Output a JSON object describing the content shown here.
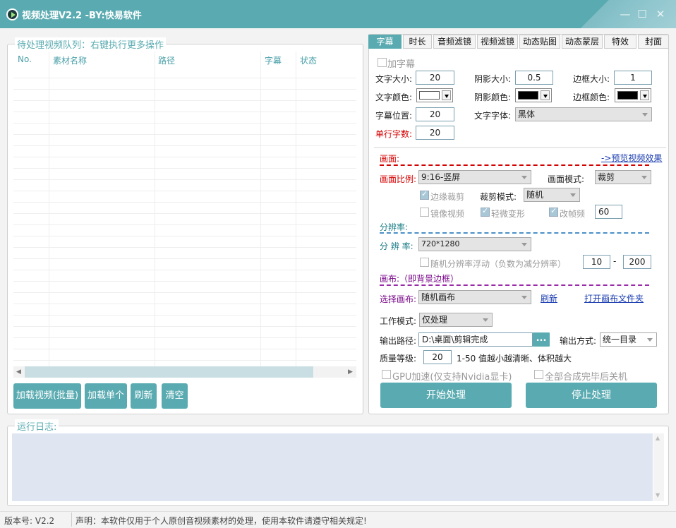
{
  "window": {
    "title": "视频处理V2.2 -BY:快易软件",
    "minimize": "—",
    "maximize": "☐",
    "close": "✕"
  },
  "queue": {
    "legend": "待处理视频队列：右键执行更多操作",
    "columns": [
      "No.",
      "素材名称",
      "路径",
      "字幕",
      "状态"
    ],
    "buttons": {
      "load_batch": "加载视频(批量)",
      "load_single": "加载单个",
      "refresh": "刷新",
      "clear": "清空"
    }
  },
  "tabs": [
    "字幕",
    "时长",
    "音频滤镜",
    "视频滤镜",
    "动态贴图",
    "动态蒙层",
    "特效",
    "封面"
  ],
  "subtitle": {
    "add_subtitle": "加字幕",
    "font_size_label": "文字大小:",
    "font_size": "20",
    "shadow_size_label": "阴影大小:",
    "shadow_size": "0.5",
    "border_size_label": "边框大小:",
    "border_size": "1",
    "font_color_label": "文字颜色:",
    "shadow_color_label": "阴影颜色:",
    "border_color_label": "边框颜色:",
    "position_label": "字幕位置:",
    "position": "20",
    "font_family_label": "文字字体:",
    "font_family": "黑体",
    "chars_per_line_label": "单行字数:",
    "chars_per_line": "20"
  },
  "frame": {
    "heading": "画面:",
    "preview_link": "->预览视频效果",
    "ratio_label": "画面比例:",
    "ratio": "9:16-竖屏",
    "mode_label": "画面模式:",
    "mode": "裁剪",
    "edge_crop": "边缘裁剪",
    "crop_mode_label": "裁剪模式:",
    "crop_mode": "随机",
    "mirror": "镜像视频",
    "slight_deform": "轻微变形",
    "change_fps": "改帧频",
    "fps": "60"
  },
  "resolution": {
    "heading": "分辨率:",
    "label": "分 辨 率:",
    "value": "720*1280",
    "random_float": "随机分辨率浮动（负数为减分辨率）",
    "min": "10",
    "dash": "-",
    "max": "200"
  },
  "canvas": {
    "heading": "画布:（即背景边框）",
    "label": "选择画布:",
    "value": "随机画布",
    "refresh_link": "刷新",
    "open_folder_link": "打开画布文件夹"
  },
  "work": {
    "mode_label": "工作模式:",
    "mode": "仅处理",
    "output_path_label": "输出路径:",
    "output_path": "D:\\桌面\\剪辑完成",
    "browse": "...",
    "output_method_label": "输出方式:",
    "output_method": "统一目录",
    "quality_label": "质量等级:",
    "quality": "20",
    "quality_hint": "1-50 值越小越清晰、体积越大",
    "gpu": "GPU加速(仅支持Nvidia显卡)",
    "shutdown": "全部合成完毕后关机",
    "start": "开始处理",
    "stop": "停止处理"
  },
  "log": {
    "legend": "运行日志:"
  },
  "status": {
    "version": "版本号: V2.2",
    "notice": "声明：本软件仅用于个人原创音视频素材的处理，使用本软件请遵守相关规定!"
  },
  "colors": {
    "accent": "#5aabb1",
    "font_color": "#ffffff",
    "shadow_color": "#000000",
    "border_color": "#000000"
  }
}
